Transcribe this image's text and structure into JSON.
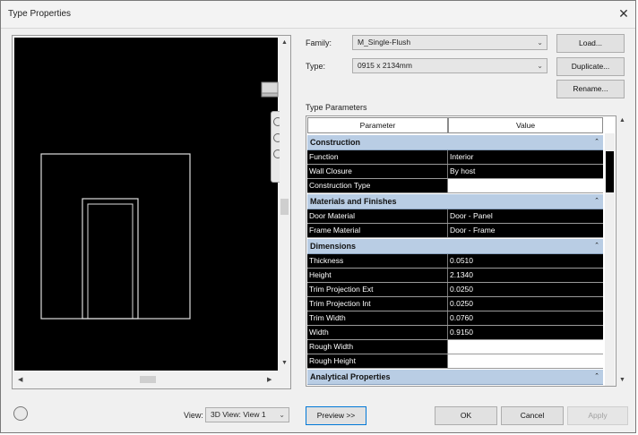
{
  "window": {
    "title": "Type Properties",
    "close_glyph": "✕"
  },
  "family": {
    "label": "Family:",
    "value": "M_Single-Flush"
  },
  "type": {
    "label": "Type:",
    "value": "0915 x 2134mm"
  },
  "buttons": {
    "load": "Load...",
    "duplicate": "Duplicate...",
    "rename": "Rename...",
    "preview": "Preview >>",
    "ok": "OK",
    "cancel": "Cancel",
    "apply": "Apply"
  },
  "type_parameters_label": "Type Parameters",
  "columns": {
    "parameter": "Parameter",
    "value": "Value"
  },
  "groups": {
    "construction": "Construction",
    "materials": "Materials and Finishes",
    "dimensions": "Dimensions",
    "analytical": "Analytical Properties"
  },
  "rows": {
    "function": {
      "name": "Function",
      "value": "Interior"
    },
    "wall_closure": {
      "name": "Wall Closure",
      "value": "By host"
    },
    "construction_type": {
      "name": "Construction Type",
      "value": ""
    },
    "door_material": {
      "name": "Door Material",
      "value": "Door - Panel"
    },
    "frame_material": {
      "name": "Frame Material",
      "value": "Door - Frame"
    },
    "thickness": {
      "name": "Thickness",
      "value": "0.0510"
    },
    "height": {
      "name": "Height",
      "value": "2.1340"
    },
    "trim_proj_ext": {
      "name": "Trim Projection Ext",
      "value": "0.0250"
    },
    "trim_proj_int": {
      "name": "Trim Projection Int",
      "value": "0.0250"
    },
    "trim_width": {
      "name": "Trim Width",
      "value": "0.0760"
    },
    "width": {
      "name": "Width",
      "value": "0.9150"
    },
    "rough_width": {
      "name": "Rough Width",
      "value": ""
    },
    "rough_height": {
      "name": "Rough Height",
      "value": ""
    }
  },
  "view": {
    "label": "View:",
    "value": "3D View: View 1"
  },
  "colors": {
    "group_band": "#b9cde4",
    "canvas": "#000000",
    "accent_border": "#0078d7"
  }
}
